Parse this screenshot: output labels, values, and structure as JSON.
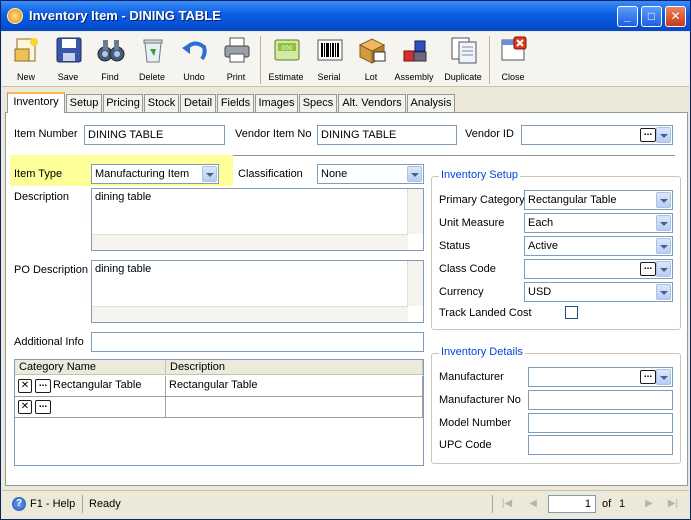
{
  "window": {
    "title": "Inventory Item - DINING TABLE",
    "min_label": "_",
    "max_label": "□",
    "close_label": "✕"
  },
  "toolbar": {
    "new": "New",
    "save": "Save",
    "find": "Find",
    "delete": "Delete",
    "undo": "Undo",
    "print": "Print",
    "estimate": "Estimate",
    "serial": "Serial",
    "lot": "Lot",
    "assembly": "Assembly",
    "duplicate": "Duplicate",
    "close": "Close"
  },
  "tabs": [
    "Inventory",
    "Setup",
    "Pricing",
    "Stock",
    "Detail",
    "Fields",
    "Images",
    "Specs",
    "Alt. Vendors",
    "Analysis"
  ],
  "form": {
    "item_number_label": "Item Number",
    "item_number": "DINING TABLE",
    "vendor_item_no_label": "Vendor Item No",
    "vendor_item_no": "DINING TABLE",
    "vendor_id_label": "Vendor ID",
    "vendor_id": "",
    "item_type_label": "Item Type",
    "item_type": "Manufacturing Item",
    "classification_label": "Classification",
    "classification": "None",
    "description_label": "Description",
    "description": "dining table",
    "po_description_label": "PO Description",
    "po_description": "dining table",
    "additional_info_label": "Additional Info",
    "additional_info": ""
  },
  "category_grid": {
    "col1": "Category Name",
    "col2": "Description",
    "rows": [
      {
        "name": "Rectangular Table",
        "description": "Rectangular Table"
      },
      {
        "name": "",
        "description": ""
      }
    ]
  },
  "inventory_setup": {
    "legend": "Inventory Setup",
    "primary_category_label": "Primary Category",
    "primary_category": "Rectangular Table",
    "unit_measure_label": "Unit Measure",
    "unit_measure": "Each",
    "status_label": "Status",
    "status": "Active",
    "class_code_label": "Class Code",
    "class_code": "",
    "currency_label": "Currency",
    "currency": "USD",
    "track_landed_cost_label": "Track Landed Cost",
    "track_landed_cost": false
  },
  "inventory_details": {
    "legend": "Inventory Details",
    "manufacturer_label": "Manufacturer",
    "manufacturer": "",
    "manufacturer_no_label": "Manufacturer No",
    "manufacturer_no": "",
    "model_number_label": "Model Number",
    "model_number": "",
    "upc_code_label": "UPC Code",
    "upc_code": ""
  },
  "statusbar": {
    "help": "F1 - Help",
    "status": "Ready",
    "page": "1",
    "of_label": "of",
    "total_pages": "1"
  }
}
